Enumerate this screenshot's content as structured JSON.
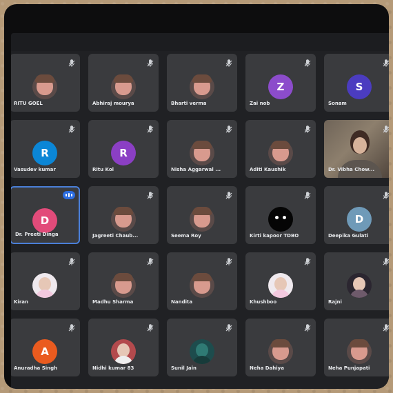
{
  "meeting": {
    "participants": [
      {
        "name": "RITU GOEL",
        "avatar_type": "cartoon-girl",
        "avatar_letter": "",
        "color": "#5a4a48",
        "active": false
      },
      {
        "name": "Abhiraj mourya",
        "avatar_type": "cartoon-girl",
        "avatar_letter": "",
        "color": "#5a4a48",
        "active": false
      },
      {
        "name": "Bharti verma",
        "avatar_type": "cartoon-girl",
        "avatar_letter": "",
        "color": "#5a4a48",
        "active": false
      },
      {
        "name": "Zai nob",
        "avatar_type": "letter",
        "avatar_letter": "Z",
        "color": "#8c4ccb",
        "active": false
      },
      {
        "name": "Sonam",
        "avatar_type": "letter",
        "avatar_letter": "S",
        "color": "#4b3cc0",
        "active": false
      },
      {
        "name": "Vasudev kumar",
        "avatar_type": "letter",
        "avatar_letter": "R",
        "color": "#0b86d6",
        "active": false
      },
      {
        "name": "Ritu Kol",
        "avatar_type": "letter",
        "avatar_letter": "R",
        "color": "#8b3fc4",
        "active": false
      },
      {
        "name": "Nisha Aggarwal ...",
        "avatar_type": "cartoon-girl",
        "avatar_letter": "",
        "color": "#5a4a48",
        "active": false
      },
      {
        "name": "Aditi Kaushik",
        "avatar_type": "cartoon-girl",
        "avatar_letter": "",
        "color": "#5a4a48",
        "active": false
      },
      {
        "name": "Dr. Vibha Chow...",
        "avatar_type": "video",
        "avatar_letter": "",
        "color": "#6f6458",
        "active": false
      },
      {
        "name": "Dr. Preeti Dinga",
        "avatar_type": "letter",
        "avatar_letter": "D",
        "color": "#e24b7a",
        "active": true
      },
      {
        "name": "Jagreeti Chaub...",
        "avatar_type": "cartoon-girl",
        "avatar_letter": "",
        "color": "#5a4a48",
        "active": false
      },
      {
        "name": "Seema Roy",
        "avatar_type": "cartoon-girl",
        "avatar_letter": "",
        "color": "#5a4a48",
        "active": false
      },
      {
        "name": "Kirti kapoor TDBO",
        "avatar_type": "alien",
        "avatar_letter": "",
        "color": "#050505",
        "active": false
      },
      {
        "name": "Deepika Gulati",
        "avatar_type": "letter",
        "avatar_letter": "D",
        "color": "#6f9ab8",
        "active": false
      },
      {
        "name": "Kiran",
        "avatar_type": "photo-light",
        "avatar_letter": "",
        "color": "#efe9ee",
        "active": false
      },
      {
        "name": "Madhu Sharma",
        "avatar_type": "cartoon-girl",
        "avatar_letter": "",
        "color": "#5a4a48",
        "active": false
      },
      {
        "name": "Nandita",
        "avatar_type": "cartoon-girl",
        "avatar_letter": "",
        "color": "#5a4a48",
        "active": false
      },
      {
        "name": "Khushboo",
        "avatar_type": "photo-light",
        "avatar_letter": "",
        "color": "#efe9ee",
        "active": false
      },
      {
        "name": "Rajni",
        "avatar_type": "photo-dark",
        "avatar_letter": "",
        "color": "#2b2630",
        "active": false
      },
      {
        "name": "Anuradha Singh",
        "avatar_type": "letter",
        "avatar_letter": "A",
        "color": "#ea5b1f",
        "active": false
      },
      {
        "name": "Nidhi kumar 83",
        "avatar_type": "photo-red",
        "avatar_letter": "",
        "color": "#b34a4d",
        "active": false
      },
      {
        "name": "Sunil Jain",
        "avatar_type": "photo-teal",
        "avatar_letter": "",
        "color": "#1d4c4d",
        "active": false
      },
      {
        "name": "Neha Dahiya",
        "avatar_type": "cartoon-girl",
        "avatar_letter": "",
        "color": "#5a4a48",
        "active": false
      },
      {
        "name": "Neha Punjapati",
        "avatar_type": "cartoon-girl",
        "avatar_letter": "",
        "color": "#5a4a48",
        "active": false
      }
    ]
  },
  "ui": {
    "icons": {
      "mute": "mute-icon",
      "active_speaker": "active-speaker-icon"
    },
    "colors": {
      "background": "#202124",
      "tile": "#3a3b3e",
      "active_border": "#4a7fd8",
      "text": "#e8eaed"
    }
  }
}
